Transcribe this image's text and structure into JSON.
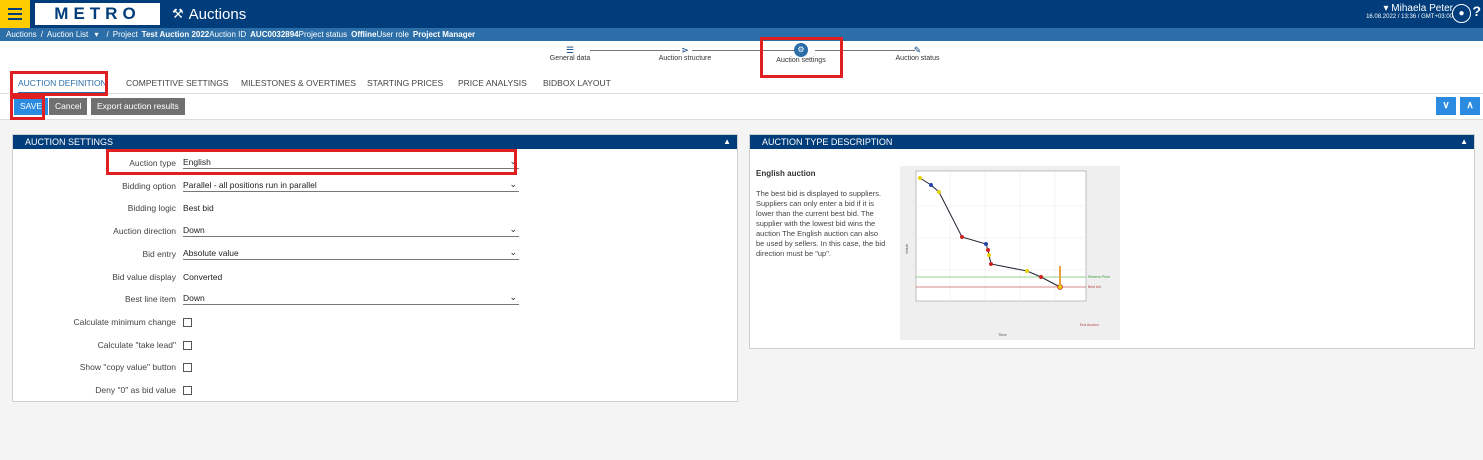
{
  "header": {
    "logo_text": "METRO",
    "app_title": "Auctions",
    "user_name": "Mihaela Peter",
    "user_time": "16.08.2022 / 13:36 / GMT+03:00",
    "help": "?"
  },
  "infobar": {
    "auctions": "Auctions",
    "auction_list": "Auction List",
    "project_label": "Project",
    "project_value": "Test Auction 2022",
    "auction_id_label": "Auction ID",
    "auction_id_value": "AUC0032894",
    "status_label": "Project status",
    "status_value": "Offline",
    "role_label": "User role",
    "role_value": "Project Manager"
  },
  "steps": [
    {
      "label": "General data",
      "icon": "database-icon"
    },
    {
      "label": "Auction structure",
      "icon": "sitemap-icon"
    },
    {
      "label": "Auction settings",
      "icon": "gear-icon"
    },
    {
      "label": "Auction status",
      "icon": "edit-icon"
    }
  ],
  "tabs": [
    {
      "label": "AUCTION DEFINITION",
      "active": true
    },
    {
      "label": "COMPETITIVE SETTINGS"
    },
    {
      "label": "MILESTONES & OVERTIMES"
    },
    {
      "label": "STARTING PRICES"
    },
    {
      "label": "PRICE ANALYSIS"
    },
    {
      "label": "BIDBOX LAYOUT"
    }
  ],
  "toolbar": {
    "save": "SAVE",
    "cancel": "Cancel",
    "export": "Export auction results"
  },
  "settings": {
    "title": "AUCTION SETTINGS",
    "fields": [
      {
        "label": "Auction type",
        "value": "English",
        "kind": "select"
      },
      {
        "label": "Bidding option",
        "value": "Parallel - all positions run in parallel",
        "kind": "select"
      },
      {
        "label": "Bidding logic",
        "value": "Best bid",
        "kind": "text"
      },
      {
        "label": "Auction direction",
        "value": "Down",
        "kind": "select"
      },
      {
        "label": "Bid entry",
        "value": "Absolute value",
        "kind": "select"
      },
      {
        "label": "Bid value display",
        "value": "Converted",
        "kind": "text"
      },
      {
        "label": "Best line item",
        "value": "Down",
        "kind": "select"
      },
      {
        "label": "Calculate minimum change",
        "kind": "checkbox"
      },
      {
        "label": "Calculate \"take lead\"",
        "kind": "checkbox"
      },
      {
        "label": "Show \"copy value\" button",
        "kind": "checkbox"
      },
      {
        "label": "Deny \"0\" as bid value",
        "kind": "checkbox"
      }
    ]
  },
  "description": {
    "title": "AUCTION TYPE DESCRIPTION",
    "heading": "English auction",
    "text": "The best bid is displayed to suppliers. Suppliers can only enter a bid if it is lower than the current best bid. The supplier with the lowest bid wins the auction The English auction can also be used by sellers. In this case, the bid direction must be \"up\".",
    "chart_labels": {
      "x_axis": "Time",
      "y_axis": "Value",
      "reserve": "Reserve Price",
      "best": "Best bid",
      "end": "End Auction"
    }
  },
  "colors": {
    "navy": "#003d7a",
    "blue": "#2b6ea8",
    "yellow": "#ffcc00",
    "save_blue": "#2b8be0",
    "highlight_red": "#e02020"
  }
}
